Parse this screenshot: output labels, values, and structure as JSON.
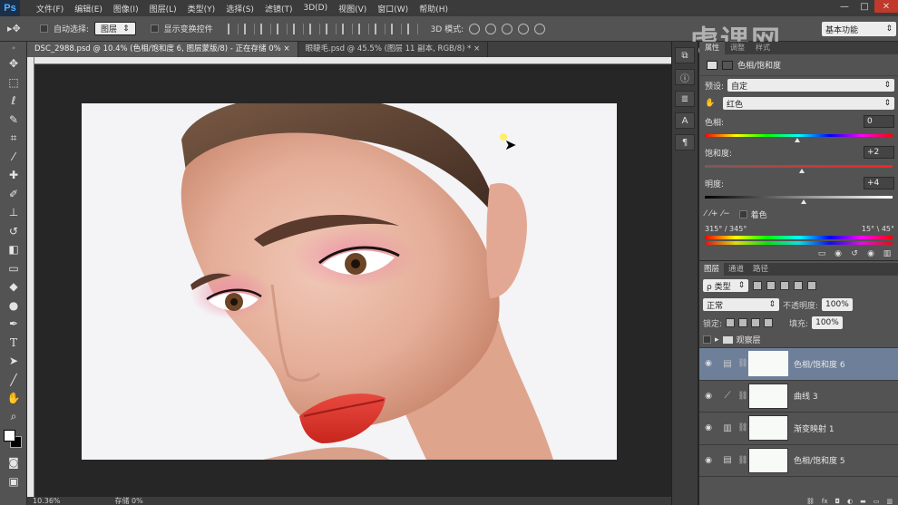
{
  "menu": {
    "logo": "Ps",
    "items": [
      "文件(F)",
      "编辑(E)",
      "图像(I)",
      "图层(L)",
      "类型(Y)",
      "选择(S)",
      "滤镜(T)",
      "3D(D)",
      "视图(V)",
      "窗口(W)",
      "帮助(H)"
    ]
  },
  "window_controls": {
    "minimize": "—",
    "restore": "□",
    "close": "✕"
  },
  "options": {
    "auto_select_label": "自动选择:",
    "auto_select_value": "图层",
    "show_transform_label": "显示变换控件",
    "mode3d_label": "3D 模式:",
    "workspace": "基本功能"
  },
  "watermark": "虎课网",
  "tabs": [
    {
      "label": "DSC_2988.psd @ 10.4% (色相/饱和度 6, 图层蒙版/8) - 正在存储 0%",
      "close": "×"
    },
    {
      "label": "眼睫毛.psd @ 45.5% (图层 11 副本, RGB/8) *",
      "close": "×"
    }
  ],
  "status": {
    "zoom": "10.36%",
    "save": "存储 0%"
  },
  "properties": {
    "tabs": [
      "属性",
      "调整",
      "样式"
    ],
    "title": "色相/饱和度",
    "preset_label": "预设:",
    "preset_value": "自定",
    "channel_value": "红色",
    "hue_label": "色相:",
    "hue_value": "0",
    "sat_label": "饱和度:",
    "sat_value": "+2",
    "light_label": "明度:",
    "light_value": "+4",
    "colorize_label": "着色",
    "range_left": "315° / 345°",
    "range_right": "15° \\ 45°"
  },
  "layers": {
    "tabs": [
      "图层",
      "通道",
      "路径"
    ],
    "filter": "ρ 类型",
    "blend_mode": "正常",
    "opacity_label": "不透明度:",
    "opacity_value": "100%",
    "lock_label": "锁定:",
    "fill_label": "填充:",
    "fill_value": "100%",
    "group_name": "观察层",
    "items": [
      {
        "name": "色相/饱和度 6",
        "icon": "hue-sat-icon",
        "selected": true
      },
      {
        "name": "曲线 3",
        "icon": "curves-icon",
        "selected": false
      },
      {
        "name": "渐变映射 1",
        "icon": "gradient-map-icon",
        "selected": false
      },
      {
        "name": "色相/饱和度 5",
        "icon": "hue-sat-icon",
        "selected": false
      }
    ]
  },
  "colors": {
    "accent_selected_layer": "#6e7f99",
    "panel_bg": "#535353",
    "canvas_bg": "#262626"
  }
}
